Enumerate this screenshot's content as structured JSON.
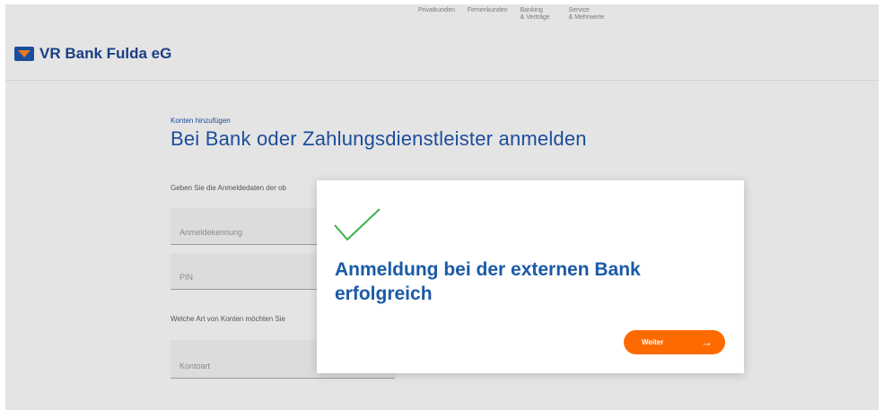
{
  "header": {
    "brand": "VR Bank Fulda eG",
    "nav": [
      {
        "label": "Privatkunden"
      },
      {
        "label": "Firmenkunden"
      },
      {
        "label": "Banking\n& Verträge"
      },
      {
        "label": "Service\n& Mehrwerte"
      }
    ]
  },
  "page": {
    "eyebrow": "Konten hinzufügen",
    "title": "Bei Bank oder Zahlungsdienstleister anmelden",
    "prompt_credentials": "Geben Sie die Anmeldedaten der ob",
    "fields": {
      "login_placeholder": "Anmeldekennung",
      "pin_placeholder": "PIN",
      "account_type_placeholder": "Kontoart"
    },
    "prompt_accounts": "Welche Art von Konten möchten Sie"
  },
  "modal": {
    "title": "Anmeldung bei der externen Bank erfolgreich",
    "button_label": "Weiter",
    "check_color": "#3cb34a",
    "button_color": "#ff6a00"
  }
}
